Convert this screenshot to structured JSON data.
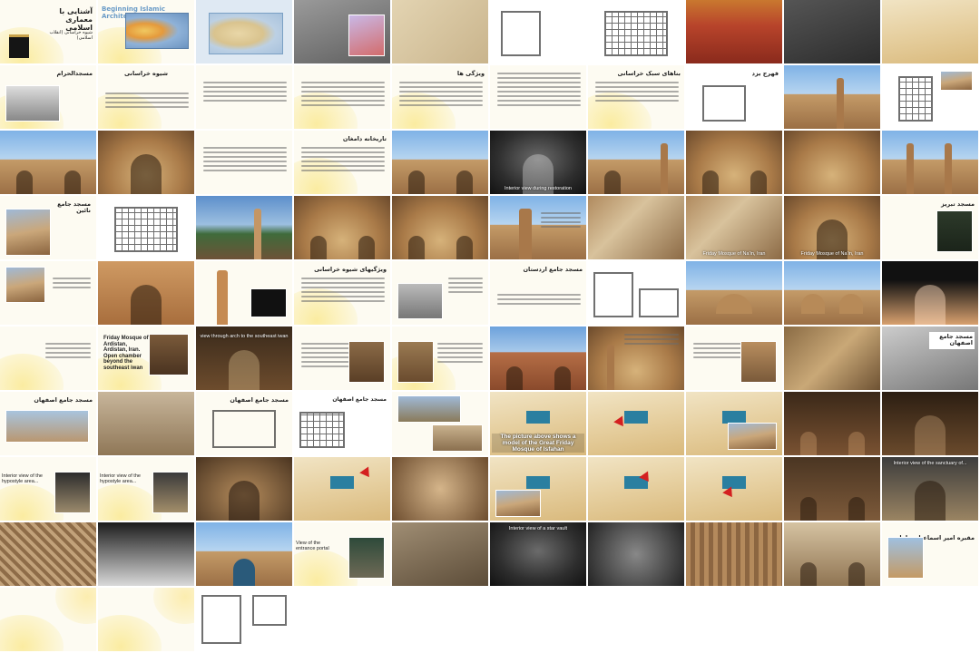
{
  "slides": [
    {
      "title": "آشنایی با معماری اسلامی",
      "subtitle": "شیوه خراسانی (انقلاب اسلامی)",
      "caption": ""
    },
    {
      "title": "Beginning Islamic Architecture",
      "caption": ""
    },
    {
      "title": "",
      "caption": ""
    },
    {
      "title": "",
      "caption": ""
    },
    {
      "title": "",
      "caption": ""
    },
    {
      "title": "",
      "caption": ""
    },
    {
      "title": "",
      "caption": ""
    },
    {
      "title": "",
      "caption": ""
    },
    {
      "title": "",
      "caption": ""
    },
    {
      "title": "",
      "caption": ""
    },
    {
      "title": "مسجدالحرام",
      "caption": ""
    },
    {
      "title": "شیوه خراسانی",
      "caption": ""
    },
    {
      "title": "",
      "caption": ""
    },
    {
      "title": "",
      "caption": ""
    },
    {
      "title": "ویژگی ها",
      "caption": ""
    },
    {
      "title": "",
      "caption": ""
    },
    {
      "title": "بناهای سبک خراسانی",
      "caption": ""
    },
    {
      "title": "فهرج یزد",
      "caption": ""
    },
    {
      "title": "",
      "caption": ""
    },
    {
      "title": "",
      "caption": ""
    },
    {
      "title": "",
      "caption": ""
    },
    {
      "title": "",
      "caption": ""
    },
    {
      "title": "",
      "caption": ""
    },
    {
      "title": "تاریخانه دامغان",
      "caption": ""
    },
    {
      "title": "",
      "caption": ""
    },
    {
      "title": "",
      "caption": "Interior view during restoration"
    },
    {
      "title": "",
      "caption": ""
    },
    {
      "title": "",
      "caption": ""
    },
    {
      "title": "",
      "caption": ""
    },
    {
      "title": "",
      "caption": ""
    },
    {
      "title": "مسجد جامع نائین",
      "caption": ""
    },
    {
      "title": "",
      "caption": ""
    },
    {
      "title": "",
      "caption": ""
    },
    {
      "title": "",
      "caption": ""
    },
    {
      "title": "",
      "caption": ""
    },
    {
      "title": "",
      "caption": ""
    },
    {
      "title": "",
      "caption": ""
    },
    {
      "title": "",
      "caption": "Friday Mosque of Na'in, Iran"
    },
    {
      "title": "",
      "caption": "Friday Mosque of Na'in, Iran"
    },
    {
      "title": "مسجد تبریز",
      "caption": ""
    },
    {
      "title": "",
      "caption": ""
    },
    {
      "title": "",
      "caption": ""
    },
    {
      "title": "",
      "caption": ""
    },
    {
      "title": "ویژگیهای شیوه خراسانی",
      "caption": ""
    },
    {
      "title": "",
      "caption": ""
    },
    {
      "title": "مسجد جامع اردستان",
      "caption": ""
    },
    {
      "title": "",
      "caption": ""
    },
    {
      "title": "",
      "caption": ""
    },
    {
      "title": "",
      "caption": ""
    },
    {
      "title": "",
      "caption": "Friday Mosque of Ardistan, Ardistan, Iran. Open chamber beyond the southeast iwan"
    },
    {
      "title": "",
      "caption": "view through arch to the southeast iwan"
    },
    {
      "title": "",
      "caption": ""
    },
    {
      "title": "",
      "caption": ""
    },
    {
      "title": "",
      "caption": ""
    },
    {
      "title": "",
      "caption": ""
    },
    {
      "title": "",
      "caption": ""
    },
    {
      "title": "",
      "caption": ""
    },
    {
      "title": "مسجد جامع اصفهان",
      "caption": ""
    },
    {
      "title": "مسجد جامع اصفهان",
      "caption": ""
    },
    {
      "title": "مسجد جامع اصفهان",
      "caption": ""
    },
    {
      "title": "مسجد جامع اصفهان",
      "caption": ""
    },
    {
      "title": "",
      "caption": ""
    },
    {
      "title": "",
      "caption": ""
    },
    {
      "title": "",
      "caption": ""
    },
    {
      "title": "",
      "caption": ""
    },
    {
      "title": "",
      "caption": ""
    },
    {
      "title": "",
      "caption": ""
    },
    {
      "title": "",
      "caption": "Interior view of the hypostyle area..."
    },
    {
      "title": "",
      "caption": "Interior view of the hypostyle area..."
    },
    {
      "title": "",
      "caption": ""
    },
    {
      "title": "",
      "caption": ""
    },
    {
      "title": "",
      "caption": ""
    },
    {
      "title": "",
      "caption": ""
    },
    {
      "title": "",
      "caption": ""
    },
    {
      "title": "",
      "caption": ""
    },
    {
      "title": "",
      "caption": ""
    },
    {
      "title": "",
      "caption": "Interior view of the sanctuary of..."
    },
    {
      "title": "",
      "caption": ""
    },
    {
      "title": "",
      "caption": ""
    },
    {
      "title": "",
      "caption": ""
    },
    {
      "title": "",
      "caption": "View of the entrance portal"
    },
    {
      "title": "",
      "caption": ""
    },
    {
      "title": "",
      "caption": ""
    },
    {
      "title": "",
      "caption": "Interior view of a star vault"
    },
    {
      "title": "",
      "caption": ""
    },
    {
      "title": "",
      "caption": ""
    },
    {
      "title": "مقبره امیر اسماعیل سامانی",
      "caption": ""
    },
    {
      "title": "",
      "caption": ""
    },
    {
      "title": "",
      "caption": ""
    },
    {
      "title": "",
      "caption": ""
    },
    {
      "title": "",
      "caption": ""
    },
    {
      "title": "",
      "caption": ""
    },
    {
      "title": "",
      "caption": ""
    },
    {
      "title": "",
      "caption": ""
    },
    {
      "title": "",
      "caption": ""
    },
    {
      "title": "",
      "caption": ""
    },
    {
      "title": "",
      "caption": ""
    },
    {
      "title": "",
      "caption": ""
    },
    {
      "title": "",
      "caption": ""
    },
    {
      "title": "",
      "caption": ""
    }
  ],
  "special_captions": {
    "model_caption": "The picture above shows a model of the Great Friday Mosque of Isfahan"
  }
}
